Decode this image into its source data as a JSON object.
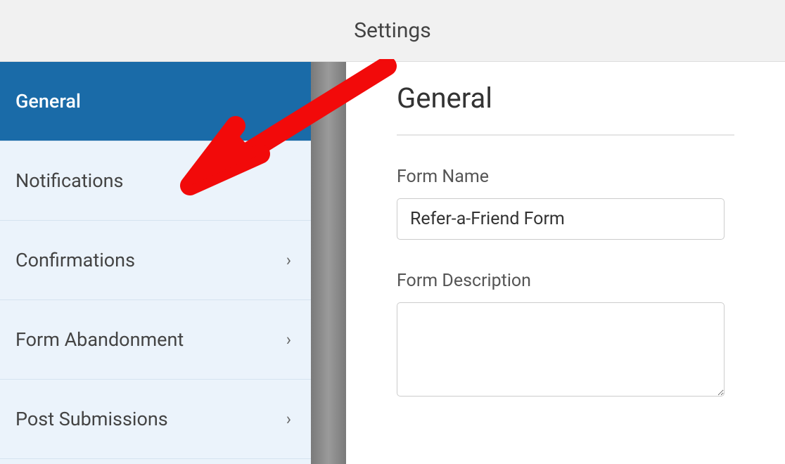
{
  "header": {
    "title": "Settings"
  },
  "sidebar": {
    "items": [
      {
        "label": "General",
        "active": true,
        "has_chevron": false
      },
      {
        "label": "Notifications",
        "active": false,
        "has_chevron": false
      },
      {
        "label": "Confirmations",
        "active": false,
        "has_chevron": true
      },
      {
        "label": "Form Abandonment",
        "active": false,
        "has_chevron": true
      },
      {
        "label": "Post Submissions",
        "active": false,
        "has_chevron": true
      }
    ]
  },
  "main": {
    "title": "General",
    "form_name_label": "Form Name",
    "form_name_value": "Refer-a-Friend Form",
    "form_description_label": "Form Description",
    "form_description_value": ""
  },
  "annotation": {
    "color": "#f20a0a",
    "target": "Notifications"
  }
}
